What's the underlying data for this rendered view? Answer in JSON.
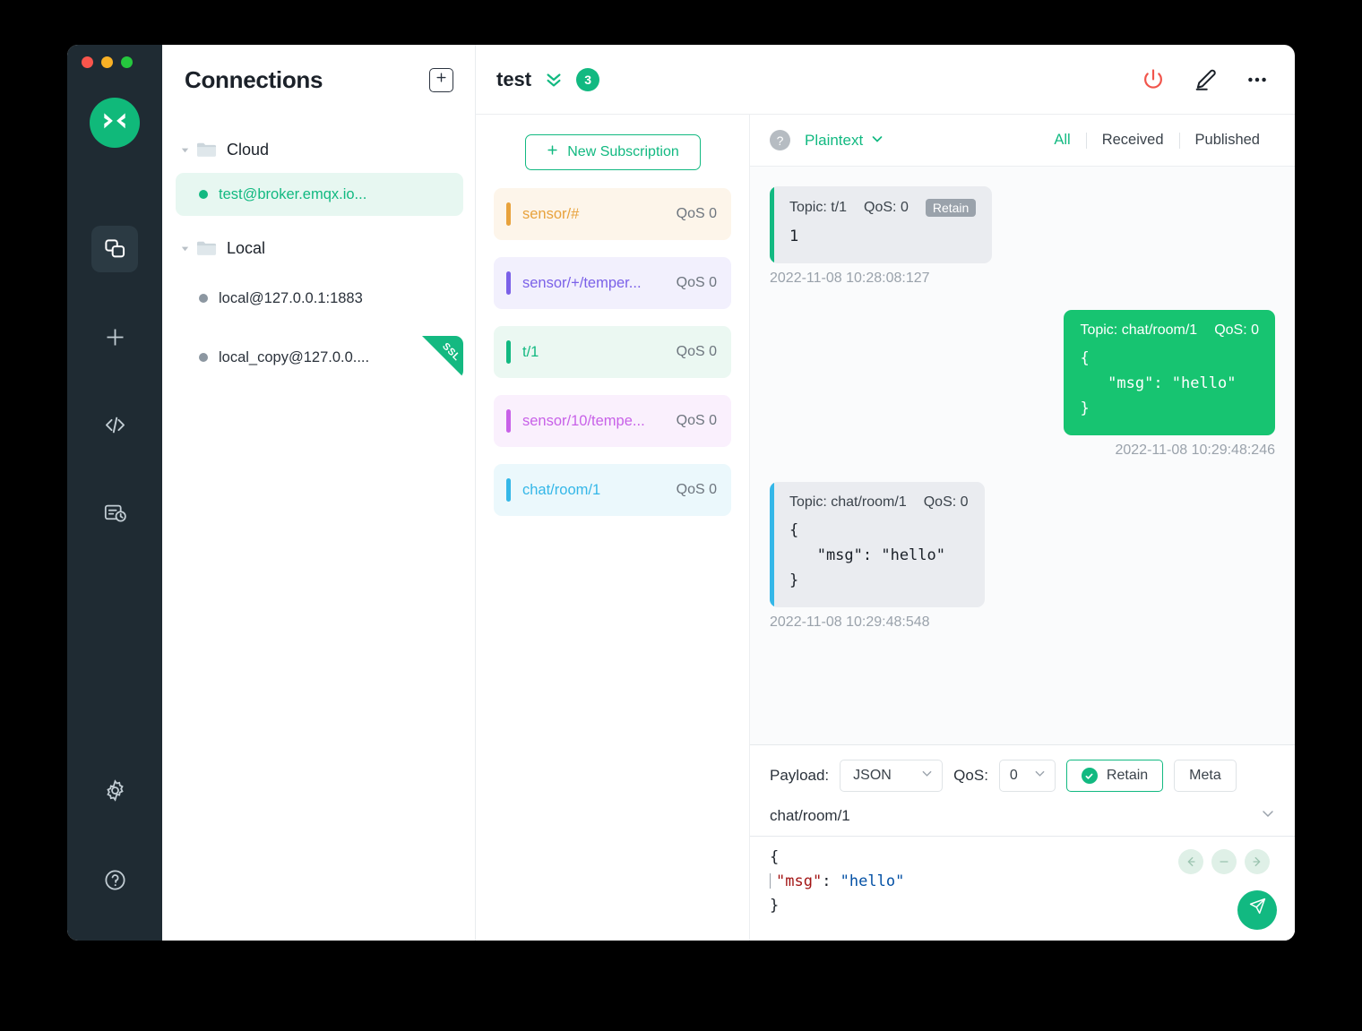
{
  "window": {
    "traffic_lights": [
      "close",
      "minimize",
      "maximize"
    ]
  },
  "rail": {
    "logo_name": "mqttx-logo",
    "items": [
      {
        "name": "connections",
        "icon": "connections-icon",
        "active": true
      },
      {
        "name": "new-connection",
        "icon": "plus-icon",
        "active": false
      },
      {
        "name": "scripts",
        "icon": "code-icon",
        "active": false
      },
      {
        "name": "log",
        "icon": "log-icon",
        "active": false
      }
    ],
    "bottom_items": [
      {
        "name": "settings",
        "icon": "gear-icon"
      },
      {
        "name": "help",
        "icon": "question-circle-icon"
      }
    ]
  },
  "connections": {
    "title": "Connections",
    "add_button_label": "+",
    "groups": [
      {
        "name": "Cloud",
        "expanded": true,
        "items": [
          {
            "label": "test@broker.emqx.io...",
            "status": "online",
            "selected": true,
            "ssl": false
          }
        ]
      },
      {
        "name": "Local",
        "expanded": true,
        "items": [
          {
            "label": "local@127.0.0.1:1883",
            "status": "offline",
            "selected": false,
            "ssl": false
          },
          {
            "label": "local_copy@127.0.0....",
            "status": "offline",
            "selected": false,
            "ssl": true,
            "ssl_label": "SSL"
          }
        ]
      }
    ]
  },
  "header": {
    "connection_name": "test",
    "message_count": "3",
    "icons": [
      "disconnect-power-icon",
      "edit-pencil-icon",
      "more-options-icon"
    ]
  },
  "subscriptions": {
    "new_subscription_label": "New Subscription",
    "items": [
      {
        "topic": "sensor/#",
        "qos": "QoS 0",
        "color": "#e8a23c",
        "bg": "#fdf5ea"
      },
      {
        "topic": "sensor/+/temper...",
        "qos": "QoS 0",
        "color": "#7b61e8",
        "bg": "#f2f0fd"
      },
      {
        "topic": "t/1",
        "qos": "QoS 0",
        "color": "#12b981",
        "bg": "#ebf8f2"
      },
      {
        "topic": "sensor/10/tempe...",
        "qos": "QoS 0",
        "color": "#c861e8",
        "bg": "#faf0fd"
      },
      {
        "topic": "chat/room/1",
        "qos": "QoS 0",
        "color": "#34b7e8",
        "bg": "#ebf8fc"
      }
    ]
  },
  "messages_toolbar": {
    "help_icon": "?",
    "format": "Plaintext",
    "filters": [
      {
        "label": "All",
        "active": true
      },
      {
        "label": "Received",
        "active": false
      },
      {
        "label": "Published",
        "active": false
      }
    ]
  },
  "messages": [
    {
      "direction": "received",
      "topic_label": "Topic: t/1",
      "qos_label": "QoS: 0",
      "retain_label": "Retain",
      "payload": "1",
      "time": "2022-11-08 10:28:08:127",
      "edge_color": "#12b981"
    },
    {
      "direction": "published",
      "topic_label": "Topic: chat/room/1",
      "qos_label": "QoS: 0",
      "retain_label": "",
      "payload": "{\n   \"msg\": \"hello\"\n}",
      "time": "2022-11-08 10:29:48:246",
      "edge_color": ""
    },
    {
      "direction": "received",
      "topic_label": "Topic: chat/room/1",
      "qos_label": "QoS: 0",
      "retain_label": "",
      "payload": "{\n   \"msg\": \"hello\"\n}",
      "time": "2022-11-08 10:29:48:548",
      "edge_color": "#34b7e8"
    }
  ],
  "publish": {
    "payload_label": "Payload:",
    "payload_format": "JSON",
    "qos_label": "QoS:",
    "qos_value": "0",
    "retain_label": "Retain",
    "retain_checked": true,
    "meta_label": "Meta",
    "topic": "chat/room/1",
    "editor": {
      "line1": "{",
      "key": "\"msg\"",
      "colon": ": ",
      "value": "\"hello\"",
      "line3": "}"
    },
    "nav_icons": [
      "arrow-left-icon",
      "minus-icon",
      "arrow-right-icon"
    ],
    "send_icon": "send-icon"
  },
  "colors": {
    "accent": "#12b981",
    "published_bubble": "#17c471",
    "received_bubble": "#eaecf0",
    "danger": "#f1554c",
    "rail_bg": "#1f2b33"
  }
}
